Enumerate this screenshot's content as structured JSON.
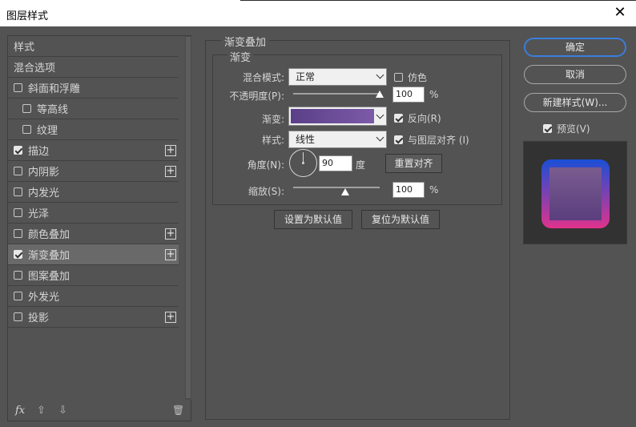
{
  "window": {
    "title": "图层样式",
    "close_glyph": "✕"
  },
  "sidebar": {
    "items": [
      {
        "label": "样式",
        "checkbox": false,
        "checked": false,
        "plus": false,
        "indent": false,
        "selected": false
      },
      {
        "label": "混合选项",
        "checkbox": false,
        "checked": false,
        "plus": false,
        "indent": false,
        "selected": false
      },
      {
        "label": "斜面和浮雕",
        "checkbox": true,
        "checked": false,
        "plus": false,
        "indent": false,
        "selected": false
      },
      {
        "label": "等高线",
        "checkbox": true,
        "checked": false,
        "plus": false,
        "indent": true,
        "selected": false
      },
      {
        "label": "纹理",
        "checkbox": true,
        "checked": false,
        "plus": false,
        "indent": true,
        "selected": false
      },
      {
        "label": "描边",
        "checkbox": true,
        "checked": true,
        "plus": true,
        "indent": false,
        "selected": false
      },
      {
        "label": "内阴影",
        "checkbox": true,
        "checked": false,
        "plus": true,
        "indent": false,
        "selected": false
      },
      {
        "label": "内发光",
        "checkbox": true,
        "checked": false,
        "plus": false,
        "indent": false,
        "selected": false
      },
      {
        "label": "光泽",
        "checkbox": true,
        "checked": false,
        "plus": false,
        "indent": false,
        "selected": false
      },
      {
        "label": "颜色叠加",
        "checkbox": true,
        "checked": false,
        "plus": true,
        "indent": false,
        "selected": false
      },
      {
        "label": "渐变叠加",
        "checkbox": true,
        "checked": true,
        "plus": true,
        "indent": false,
        "selected": true
      },
      {
        "label": "图案叠加",
        "checkbox": true,
        "checked": false,
        "plus": false,
        "indent": false,
        "selected": false
      },
      {
        "label": "外发光",
        "checkbox": true,
        "checked": false,
        "plus": false,
        "indent": false,
        "selected": false
      },
      {
        "label": "投影",
        "checkbox": true,
        "checked": false,
        "plus": true,
        "indent": false,
        "selected": false
      }
    ],
    "plus_glyph": "+",
    "tools": {
      "fx": "fx",
      "up": "⇧",
      "down": "⇩",
      "trash": "🗑"
    }
  },
  "panel": {
    "group_title": "渐变叠加",
    "subgroup_title": "渐变",
    "blend_mode_label": "混合模式:",
    "blend_mode_value": "正常",
    "dither_label": "仿色",
    "dither_checked": false,
    "opacity_label": "不透明度(P):",
    "opacity_value": "100",
    "opacity_unit": "%",
    "opacity_level": 1.0,
    "gradient_label": "渐变:",
    "gradient_colors": [
      "#5a3f88",
      "#7c5aa8"
    ],
    "reverse_label": "反向(R)",
    "reverse_checked": true,
    "style_label": "样式:",
    "style_value": "线性",
    "align_label": "与图层对齐 (I)",
    "align_checked": true,
    "angle_label": "角度(N):",
    "angle_value": "90",
    "angle_unit": "度",
    "reset_align_label": "重置对齐",
    "scale_label": "缩放(S):",
    "scale_value": "100",
    "scale_unit": "%",
    "scale_level": 0.6,
    "set_default_label": "设置为默认值",
    "reset_default_label": "复位为默认值"
  },
  "actions": {
    "ok_label": "确定",
    "cancel_label": "取消",
    "new_style_label": "新建样式(W)...",
    "preview_label": "预览(V)",
    "preview_checked": true
  },
  "colors": {
    "accent": "#3a7fe0",
    "preview_border_top": "#1a4fd6",
    "preview_border_bottom": "#e0338c",
    "preview_fill_top": "#7a5c8f",
    "preview_fill_bottom": "#5a3e7e"
  }
}
